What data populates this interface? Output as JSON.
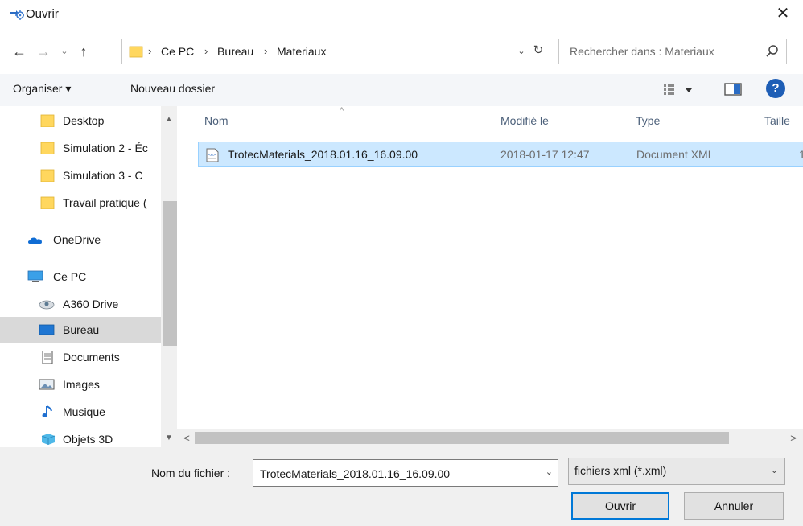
{
  "window": {
    "title": "Ouvrir",
    "close_glyph": "✕",
    "icon": "open-folder-app-icon"
  },
  "address": {
    "nav_back_glyph": "←",
    "nav_forward_glyph": "→",
    "nav_recent_glyph": "⌄",
    "nav_up_glyph": "↑",
    "breadcrumbs": [
      "Ce PC",
      "Bureau",
      "Materiaux"
    ],
    "separator": "›",
    "dropdown_glyph": "⌄",
    "refresh_glyph": "↻"
  },
  "search": {
    "placeholder": "Rechercher dans : Materiaux"
  },
  "toolbar": {
    "organize_label": "Organiser ▾",
    "new_folder_label": "Nouveau dossier",
    "help_glyph": "?"
  },
  "navigation": {
    "items": [
      {
        "label": "Desktop",
        "icon": "folder-icon"
      },
      {
        "label": "Simulation 2 - Éc",
        "icon": "folder-icon"
      },
      {
        "label": "Simulation 3 - C",
        "icon": "folder-icon"
      },
      {
        "label": "Travail pratique (",
        "icon": "folder-icon"
      },
      {
        "label": "OneDrive",
        "icon": "onedrive-icon"
      },
      {
        "label": "Ce PC",
        "icon": "computer-icon"
      },
      {
        "label": "A360 Drive",
        "icon": "a360-drive-icon"
      },
      {
        "label": "Bureau",
        "icon": "desktop-icon",
        "selected": true
      },
      {
        "label": "Documents",
        "icon": "documents-icon"
      },
      {
        "label": "Images",
        "icon": "images-icon"
      },
      {
        "label": "Musique",
        "icon": "music-icon"
      },
      {
        "label": "Objets 3D",
        "icon": "objects-3d-icon"
      }
    ],
    "scroll_up_glyph": "▲",
    "scroll_down_glyph": "▼"
  },
  "filelist": {
    "columns": [
      "Nom",
      "Modifié le",
      "Type",
      "Taille"
    ],
    "sort_glyph": "^",
    "rows": [
      {
        "name": "TrotecMaterials_2018.01.16_16.09.00",
        "modified": "2018-01-17 12:47",
        "type": "Document XML",
        "size": "1",
        "selected": true
      }
    ],
    "hscroll_left_glyph": "<",
    "hscroll_right_glyph": ">"
  },
  "bottom": {
    "filename_label": "Nom du fichier :",
    "filename_value": "TrotecMaterials_2018.01.16_16.09.00",
    "filename_dd_glyph": "⌄",
    "filetype_value": "fichiers xml (*.xml)",
    "filetype_dd_glyph": "⌄",
    "open_label": "Ouvrir",
    "cancel_label": "Annuler"
  },
  "colors": {
    "accent": "#0078d7",
    "selection_bg": "#cce8ff",
    "selection_border": "#99d1ff",
    "folder_yellow": "#ffd75e",
    "help_blue": "#1e5eb6"
  }
}
